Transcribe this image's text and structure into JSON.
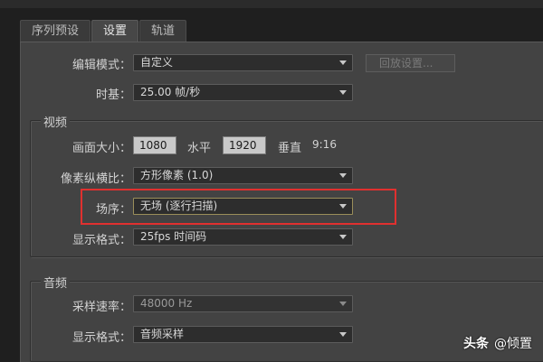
{
  "tabs": [
    {
      "label": "序列预设"
    },
    {
      "label": "设置"
    },
    {
      "label": "轨道"
    }
  ],
  "edit_mode": {
    "label": "编辑模式：",
    "value": "自定义"
  },
  "reset_button": {
    "label": "回放设置..."
  },
  "timebase": {
    "label": "时基：",
    "value": "25.00  帧/秒"
  },
  "video": {
    "section_label": "视频",
    "frame_size": {
      "label": "画面大小：",
      "width": "1080",
      "h_label": "水平",
      "height": "1920",
      "v_label": "垂直",
      "ratio": "9:16"
    },
    "pixel_aspect": {
      "label": "像素纵横比：",
      "value": "方形像素 (1.0)"
    },
    "fields": {
      "label": "场序：",
      "value": "无场 (逐行扫描)"
    },
    "display_format": {
      "label": "显示格式：",
      "value": "25fps 时间码"
    }
  },
  "audio": {
    "section_label": "音频",
    "sample_rate": {
      "label": "采样速率：",
      "value": "48000 Hz"
    },
    "display_format": {
      "label": "显示格式：",
      "value": "音频采样"
    }
  },
  "watermark": {
    "brand": "头条",
    "text": "@倾置"
  },
  "colors": {
    "highlight_box": "#e0302f",
    "panel_bg": "#434343"
  }
}
